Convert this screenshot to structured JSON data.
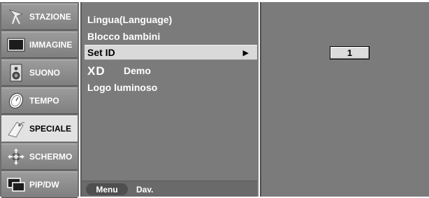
{
  "sidebar": {
    "items": [
      {
        "label": "STAZIONE",
        "icon": "antenna-icon",
        "active": false
      },
      {
        "label": "IMMAGINE",
        "icon": "picture-icon",
        "active": false
      },
      {
        "label": "SUONO",
        "icon": "speaker-icon",
        "active": false
      },
      {
        "label": "TEMPO",
        "icon": "clock-icon",
        "active": false
      },
      {
        "label": "SPECIALE",
        "icon": "tag-icon",
        "active": true
      },
      {
        "label": "SCHERMO",
        "icon": "screen-adjust-icon",
        "active": false
      },
      {
        "label": "PIP/DW",
        "icon": "pip-icon",
        "active": false
      }
    ]
  },
  "submenu": {
    "items": [
      {
        "label": "Lingua(Language)"
      },
      {
        "label": "Blocco bambini"
      },
      {
        "label": "Set ID",
        "selected": true,
        "arrow": "▶"
      },
      {
        "label": "Demo",
        "logo_text": "XD"
      },
      {
        "label": "Logo luminoso"
      }
    ]
  },
  "bottom_bar": {
    "menu_label": "Menu",
    "hint_label": "Dav."
  },
  "value_panel": {
    "set_id_value": "1"
  },
  "colors": {
    "panel_bg": "#7b7b7b",
    "sidebar_bg": "#6e6e6e",
    "active_bg": "#e2e2e2",
    "selected_bg": "#d9d9d9"
  }
}
